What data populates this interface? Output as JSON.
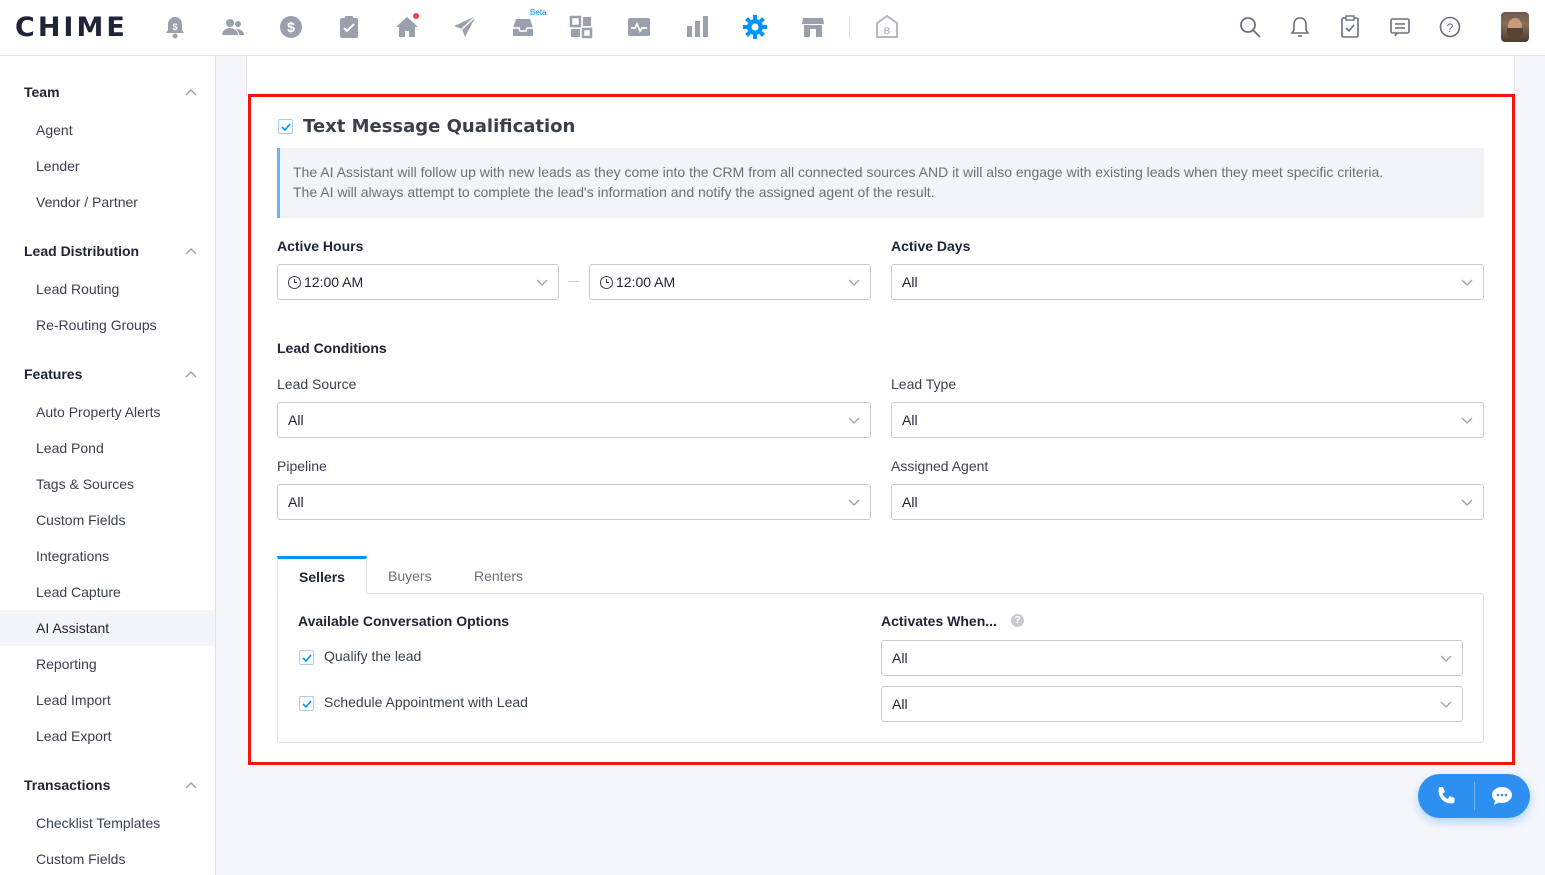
{
  "app": {
    "logo": "CHIME"
  },
  "topnav": {
    "beta_label": "Beta",
    "icons": [
      "alert-bell-icon",
      "team-icon",
      "dollar-icon",
      "clipboard-icon",
      "home-icon",
      "send-icon",
      "inbox-icon",
      "dashboard-grid-icon",
      "activity-icon",
      "bar-chart-icon",
      "settings-gear-icon",
      "storefront-icon",
      "building-icon"
    ],
    "right_icons": [
      "search-icon",
      "notification-bell-icon",
      "task-icon",
      "message-icon",
      "help-icon",
      "avatar"
    ]
  },
  "sidebar": {
    "team": {
      "title": "Team",
      "items": [
        "Agent",
        "Lender",
        "Vendor / Partner"
      ]
    },
    "lead_distribution": {
      "title": "Lead Distribution",
      "items": [
        "Lead Routing",
        "Re-Routing Groups"
      ]
    },
    "features": {
      "title": "Features",
      "items": [
        "Auto Property Alerts",
        "Lead Pond",
        "Tags & Sources",
        "Custom Fields",
        "Integrations",
        "Lead Capture",
        "AI Assistant",
        "Reporting",
        "Lead Import",
        "Lead Export"
      ]
    },
    "transactions": {
      "title": "Transactions",
      "items": [
        "Checklist Templates",
        "Custom Fields"
      ]
    },
    "active_item": "AI Assistant"
  },
  "card": {
    "title": "Text Message Qualification",
    "enabled": true,
    "info_line1": "The AI Assistant will follow up with new leads as they come into the CRM from all connected sources AND it will also engage with existing leads when they meet specific criteria.",
    "info_line2": "The AI will always attempt to complete the lead's information and notify the assigned agent of the result.",
    "active_hours": {
      "label": "Active Hours",
      "start": "12:00 AM",
      "end": "12:00 AM"
    },
    "active_days": {
      "label": "Active Days",
      "value": "All"
    },
    "lead_conditions": {
      "title": "Lead Conditions",
      "lead_source": {
        "label": "Lead Source",
        "value": "All"
      },
      "lead_type": {
        "label": "Lead Type",
        "value": "All"
      },
      "pipeline": {
        "label": "Pipeline",
        "value": "All"
      },
      "assigned_agent": {
        "label": "Assigned Agent",
        "value": "All"
      }
    },
    "tabs": {
      "sellers": "Sellers",
      "buyers": "Buyers",
      "renters": "Renters",
      "active": "Sellers"
    },
    "conversation": {
      "options_title": "Available Conversation Options",
      "activates_title": "Activates When...",
      "help": "?",
      "options": [
        {
          "label": "Qualify the lead",
          "checked": true,
          "activates": "All"
        },
        {
          "label": "Schedule Appointment with Lead",
          "checked": true,
          "activates": "All"
        }
      ]
    }
  },
  "colors": {
    "accent": "#0094ff",
    "highlight_border": "#f5130c",
    "info_bar": "#5fb8f5"
  }
}
